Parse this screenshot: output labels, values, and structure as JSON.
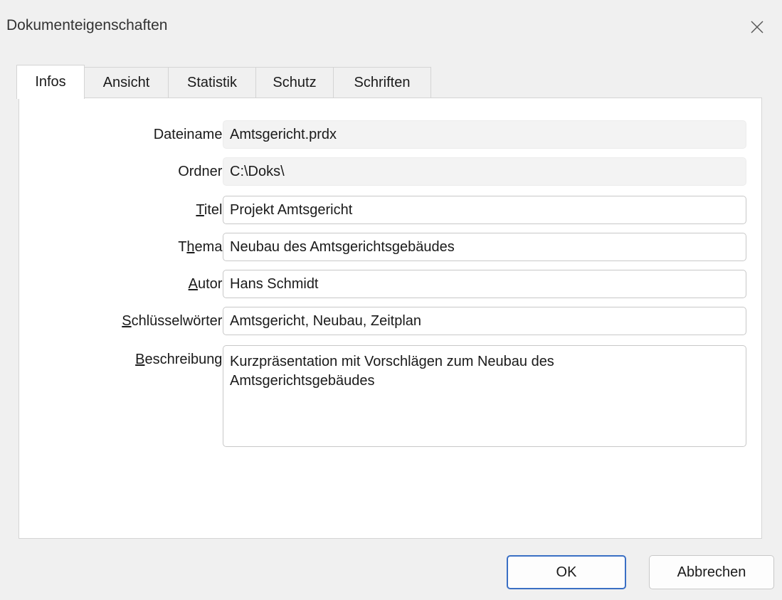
{
  "window": {
    "title": "Dokumenteigenschaften"
  },
  "tabs": [
    {
      "label": "Infos",
      "active": true
    },
    {
      "label": "Ansicht",
      "active": false
    },
    {
      "label": "Statistik",
      "active": false
    },
    {
      "label": "Schutz",
      "active": false
    },
    {
      "label": "Schriften",
      "active": false
    }
  ],
  "fields": {
    "dateiname": {
      "label": "Dateiname:",
      "value": "Amtsgericht.prdx"
    },
    "ordner": {
      "label": "Ordner:",
      "value": "C:\\Doks\\"
    },
    "titel": {
      "label_access": "T",
      "label_rest": "itel:",
      "value": "Projekt Amtsgericht"
    },
    "thema": {
      "label_pre": "T",
      "label_access": "h",
      "label_rest": "ema:",
      "value": "Neubau des Amtsgerichtsgebäudes"
    },
    "autor": {
      "label_access": "A",
      "label_rest": "utor:",
      "value": "Hans Schmidt"
    },
    "schluesselwoerter": {
      "label_access": "S",
      "label_rest": "chlüsselwörter:",
      "value": "Amtsgericht, Neubau, Zeitplan"
    },
    "beschreibung": {
      "label_access": "B",
      "label_rest": "eschreibung:",
      "value": "Kurzpräsentation mit Vorschlägen zum Neubau des\nAmtsgerichtsgebäudes"
    }
  },
  "buttons": {
    "ok": "OK",
    "cancel": "Abbrechen"
  },
  "icons": {
    "close": "close-icon"
  }
}
